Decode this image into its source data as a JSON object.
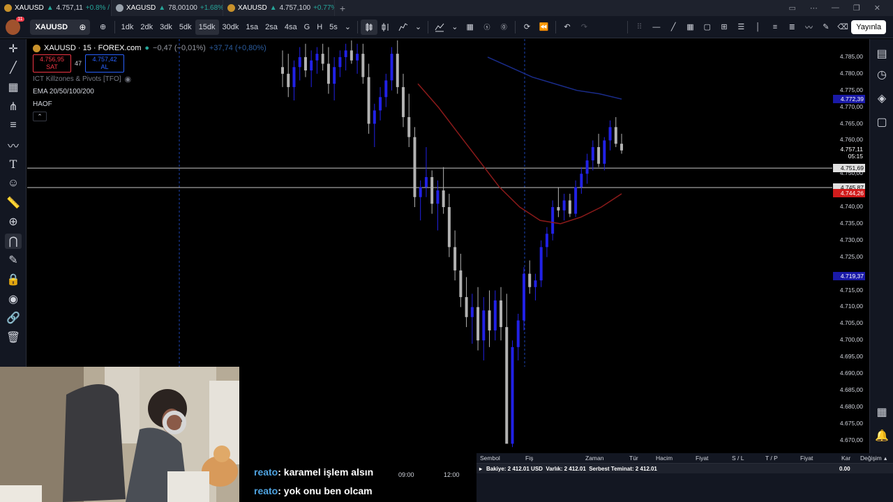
{
  "tabs": [
    {
      "symbol": "XAUUSD",
      "price": "4.757,11",
      "change": "+0.8% /",
      "coin": "gold"
    },
    {
      "symbol": "XAGUSD",
      "price": "78,00100",
      "change": "+1.68%",
      "coin": "silver"
    },
    {
      "symbol": "XAUUSD",
      "price": "4.757,100",
      "change": "+0.77%",
      "coin": "gold"
    }
  ],
  "avatar_badge": "11",
  "symbol_search": "XAUUSD",
  "intervals": [
    "1dk",
    "2dk",
    "3dk",
    "5dk",
    "15dk",
    "30dk",
    "1sa",
    "2sa",
    "4sa",
    "G",
    "H",
    "5s"
  ],
  "selected_interval": "15dk",
  "publish_label": "Yayınla",
  "legend": {
    "title": "XAUUSD · 15 · FOREX.com",
    "change": "−0,47 (−0,01%)",
    "extra": "+37,74 (+0,80%)",
    "sell_price": "4.756,95",
    "sell_label": "SAT",
    "spread": "47",
    "buy_price": "4.757,42",
    "buy_label": "AL",
    "indicator1": "ICT Killzones & Pivots [TFO]",
    "indicator2": "EMA 20/50/100/200",
    "indicator3": "HAOF"
  },
  "price_axis": {
    "ticks": [
      "4.785,00",
      "4.780,00",
      "4.775,00",
      "4.770,00",
      "4.765,00",
      "4.760,00",
      "4.750,00",
      "4.740,00",
      "4.735,00",
      "4.730,00",
      "4.725,00",
      "4.715,00",
      "4.710,00",
      "4.705,00",
      "4.700,00",
      "4.695,00",
      "4.690,00",
      "4.685,00",
      "4.680,00",
      "4.675,00",
      "4.670,00"
    ],
    "ema_blue_label": "4.772,39",
    "last_price": "4.757,11",
    "countdown": "05:15",
    "line1_label": "4.751,69",
    "line2_label": "4.745,87",
    "ema_red_label": "4.744,26",
    "blue_low_label": "4.719,37"
  },
  "time_axis": [
    "09:00",
    "12:00"
  ],
  "chat": [
    {
      "user": "reato",
      "message": ": karamel işlem alsın"
    },
    {
      "user": "reato",
      "message": ": yok onu ben olcam"
    }
  ],
  "positions_panel": {
    "headers": [
      "Sembol",
      "Fiş",
      "Zaman",
      "Tür",
      "Hacim",
      "Fiyat",
      "S / L",
      "T / P",
      "Fiyat",
      "Kar",
      "Değişim"
    ],
    "account_row": "Bakiye: 2 412.01 USD  Varlık: 2 412.01  Serbest Teminat: 2 412.01",
    "profit": "0.00"
  },
  "colors": {
    "bull": "#2121e6",
    "bear": "#b2b2b2",
    "ema_red": "#8b1a1a",
    "ema_blue": "#1a2c8b",
    "sell": "#f23645",
    "buy": "#2962ff"
  },
  "chart_data": {
    "type": "candlestick",
    "symbol": "XAUUSD",
    "interval": "15",
    "ylim": [
      4667,
      4790
    ],
    "horizontal_lines": [
      4751.69,
      4745.87
    ],
    "candles": [
      [
        4782,
        4787,
        4776,
        4780
      ],
      [
        4780,
        4786,
        4773,
        4776
      ],
      [
        4776,
        4784,
        4772,
        4782
      ],
      [
        4782,
        4788,
        4778,
        4785
      ],
      [
        4785,
        4789,
        4779,
        4781
      ],
      [
        4781,
        4787,
        4776,
        4784
      ],
      [
        4784,
        4788,
        4780,
        4786
      ],
      [
        4786,
        4789,
        4781,
        4783
      ],
      [
        4783,
        4788,
        4774,
        4777
      ],
      [
        4777,
        4785,
        4772,
        4782
      ],
      [
        4782,
        4787,
        4779,
        4785
      ],
      [
        4785,
        4789,
        4781,
        4787
      ],
      [
        4787,
        4790,
        4783,
        4784
      ],
      [
        4784,
        4789,
        4780,
        4786
      ],
      [
        4786,
        4789,
        4777,
        4779
      ],
      [
        4779,
        4783,
        4762,
        4765
      ],
      [
        4765,
        4771,
        4758,
        4769
      ],
      [
        4769,
        4776,
        4766,
        4773
      ],
      [
        4773,
        4780,
        4770,
        4778
      ],
      [
        4778,
        4788,
        4775,
        4786
      ],
      [
        4786,
        4790,
        4774,
        4776
      ],
      [
        4776,
        4780,
        4764,
        4767
      ],
      [
        4767,
        4774,
        4758,
        4761
      ],
      [
        4761,
        4764,
        4740,
        4743
      ],
      [
        4743,
        4748,
        4736,
        4746
      ],
      [
        4746,
        4758,
        4743,
        4749
      ],
      [
        4749,
        4751,
        4738,
        4741
      ],
      [
        4741,
        4748,
        4733,
        4745
      ],
      [
        4745,
        4752,
        4738,
        4740
      ],
      [
        4740,
        4744,
        4725,
        4728
      ],
      [
        4728,
        4733,
        4718,
        4721
      ],
      [
        4721,
        4726,
        4710,
        4713
      ],
      [
        4713,
        4719,
        4704,
        4707
      ],
      [
        4707,
        4714,
        4699,
        4710
      ],
      [
        4710,
        4716,
        4697,
        4700
      ],
      [
        4700,
        4713,
        4694,
        4709
      ],
      [
        4709,
        4715,
        4698,
        4703
      ],
      [
        4703,
        4715,
        4700,
        4712
      ],
      [
        4712,
        4716,
        4700,
        4704
      ],
      [
        4704,
        4714,
        4682,
        4669
      ],
      [
        4669,
        4700,
        4668,
        4698
      ],
      [
        4698,
        4708,
        4694,
        4706
      ],
      [
        4706,
        4722,
        4703,
        4720
      ],
      [
        4720,
        4724,
        4714,
        4716
      ],
      [
        4716,
        4720,
        4712,
        4718
      ],
      [
        4718,
        4730,
        4716,
        4728
      ],
      [
        4728,
        4734,
        4725,
        4732
      ],
      [
        4732,
        4742,
        4730,
        4740
      ],
      [
        4740,
        4746,
        4737,
        4739
      ],
      [
        4739,
        4744,
        4736,
        4742
      ],
      [
        4742,
        4744,
        4737,
        4738
      ],
      [
        4738,
        4748,
        4737,
        4746
      ],
      [
        4746,
        4752,
        4744,
        4750
      ],
      [
        4750,
        4756,
        4747,
        4754
      ],
      [
        4754,
        4760,
        4751,
        4758
      ],
      [
        4758,
        4762,
        4752,
        4753
      ],
      [
        4753,
        4761,
        4751,
        4760
      ],
      [
        4760,
        4766,
        4757,
        4764
      ],
      [
        4764,
        4767,
        4758,
        4759
      ],
      [
        4759,
        4762,
        4756,
        4757
      ]
    ],
    "ema_red": [
      4777,
      4770,
      4762,
      4754,
      4746,
      4740,
      4736,
      4735,
      4737,
      4740,
      4744
    ],
    "ema_blue": [
      4785,
      4782,
      4779,
      4777,
      4775,
      4774,
      4772.4
    ]
  }
}
